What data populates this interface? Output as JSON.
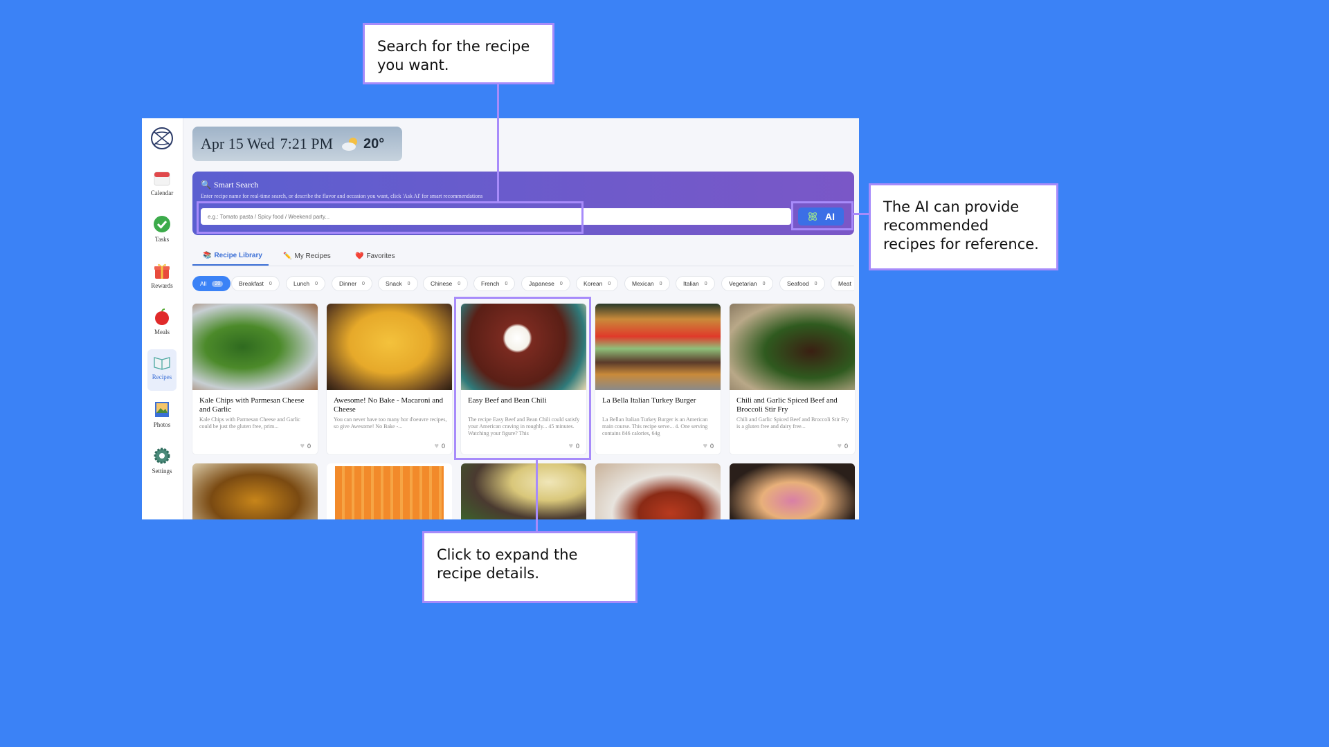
{
  "sidebar": {
    "items": [
      {
        "label": "Calendar",
        "icon": "calendar-icon"
      },
      {
        "label": "Tasks",
        "icon": "check-icon"
      },
      {
        "label": "Rewards",
        "icon": "gift-icon"
      },
      {
        "label": "Meals",
        "icon": "apple-icon"
      },
      {
        "label": "Recipes",
        "icon": "book-icon"
      },
      {
        "label": "Photos",
        "icon": "photo-icon"
      },
      {
        "label": "Settings",
        "icon": "gear-icon"
      }
    ]
  },
  "header": {
    "month_day": "Apr 15 Wed",
    "time": "7:21 PM",
    "temp": "20°"
  },
  "search": {
    "title": "Smart Search",
    "hint": "Enter recipe name for real-time search, or describe the flavor and occasion you want, click 'Ask AI' for smart recommendations",
    "placeholder": "e.g.: Tomato pasta / Spicy food / Weekend party...",
    "ai_label": "AI"
  },
  "tabs": [
    {
      "label": "Recipe Library",
      "icon": "📚"
    },
    {
      "label": "My Recipes",
      "icon": "✏️"
    },
    {
      "label": "Favorites",
      "icon": "❤️"
    }
  ],
  "chips": [
    {
      "label": "All",
      "count": "20"
    },
    {
      "label": "Breakfast",
      "count": "0"
    },
    {
      "label": "Lunch",
      "count": "0"
    },
    {
      "label": "Dinner",
      "count": "0"
    },
    {
      "label": "Snack",
      "count": "0"
    },
    {
      "label": "Chinese",
      "count": "0"
    },
    {
      "label": "French",
      "count": "0"
    },
    {
      "label": "Japanese",
      "count": "0"
    },
    {
      "label": "Korean",
      "count": "0"
    },
    {
      "label": "Mexican",
      "count": "0"
    },
    {
      "label": "Italian",
      "count": "0"
    },
    {
      "label": "Vegetarian",
      "count": "0"
    },
    {
      "label": "Seafood",
      "count": "0"
    },
    {
      "label": "Meat",
      "count": ""
    }
  ],
  "recipes": [
    {
      "title": "Kale Chips with Parmesan Cheese and Garlic",
      "desc": "Kale Chips with Parmesan Cheese and Garlic could be just the gluten free, prim...",
      "likes": "0"
    },
    {
      "title": "Awesome! No Bake - Macaroni and Cheese",
      "desc": "You can never have too many hor d'oeuvre recipes, so give Awesome! No Bake -...",
      "likes": "0"
    },
    {
      "title": "Easy Beef and Bean Chili",
      "desc": "The recipe Easy Beef and Bean Chili could satisfy your American craving in roughly... 45 minutes. Watching your figure? This",
      "likes": "0"
    },
    {
      "title": "La Bella Italian Turkey Burger",
      "desc": "La Bellan Italian Turkey Burger is an American main course. This recipe serve... 4. One serving contains 846 calories, 64g",
      "likes": "0"
    },
    {
      "title": "Chili and Garlic Spiced Beef and Broccoli Stir Fry",
      "desc": "Chili and Garlic Spiced Beef and Broccoli Stir Fry is a gluten free and dairy free...",
      "likes": "0"
    }
  ],
  "callouts": {
    "search": "Search for the recipe you want.",
    "ai": "The AI can provide recommended recipes for reference.",
    "expand": "Click to expand the recipe details."
  }
}
